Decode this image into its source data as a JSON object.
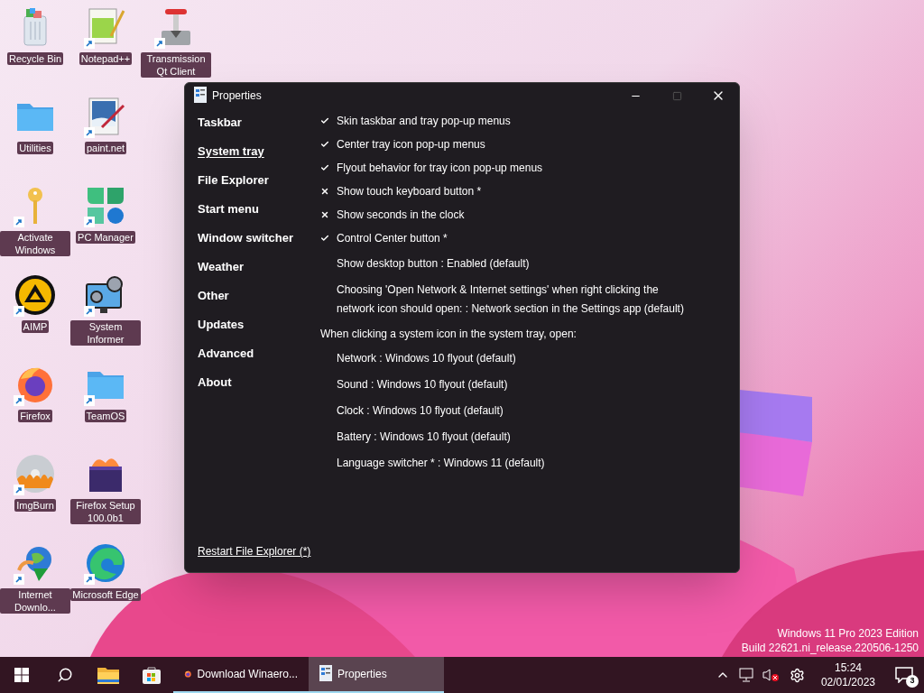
{
  "desktop_icons": [
    {
      "label": "Recycle Bin",
      "kind": "recycle",
      "shortcut": false
    },
    {
      "label": "Utilities",
      "kind": "folder",
      "shortcut": false
    },
    {
      "label": "Activate Windows",
      "kind": "key",
      "shortcut": true
    },
    {
      "label": "AIMP",
      "kind": "aimp",
      "shortcut": true
    },
    {
      "label": "Firefox",
      "kind": "firefox",
      "shortcut": true
    },
    {
      "label": "ImgBurn",
      "kind": "disc",
      "shortcut": true
    },
    {
      "label": "Internet Downlo...",
      "kind": "globe",
      "shortcut": true
    },
    {
      "label": "Notepad++",
      "kind": "notepad",
      "shortcut": true
    },
    {
      "label": "paint.net",
      "kind": "paint",
      "shortcut": true
    },
    {
      "label": "PC Manager",
      "kind": "pcmanager",
      "shortcut": true
    },
    {
      "label": "System Informer",
      "kind": "monitor",
      "shortcut": true
    },
    {
      "label": "TeamOS",
      "kind": "folder",
      "shortcut": true
    },
    {
      "label": "Firefox Setup 100.0b1",
      "kind": "setup",
      "shortcut": false
    },
    {
      "label": "Microsoft Edge",
      "kind": "edge",
      "shortcut": true
    },
    {
      "label": "Transmission Qt Client",
      "kind": "transmission",
      "shortcut": true
    }
  ],
  "window": {
    "title": "Properties",
    "sidebar": [
      {
        "label": "Taskbar",
        "selected": false
      },
      {
        "label": "System tray",
        "selected": true
      },
      {
        "label": "File Explorer",
        "selected": false
      },
      {
        "label": "Start menu",
        "selected": false
      },
      {
        "label": "Window switcher",
        "selected": false
      },
      {
        "label": "Weather",
        "selected": false
      },
      {
        "label": "Other",
        "selected": false
      },
      {
        "label": "Updates",
        "selected": false
      },
      {
        "label": "Advanced",
        "selected": false
      },
      {
        "label": "About",
        "selected": false
      }
    ],
    "settings": [
      {
        "kind": "toggle",
        "label": "Skin taskbar and tray pop-up menus",
        "checked": true
      },
      {
        "kind": "toggle",
        "label": "Center tray icon pop-up menus",
        "checked": true
      },
      {
        "kind": "toggle",
        "label": "Flyout behavior for tray icon pop-up menus",
        "checked": true
      },
      {
        "kind": "toggle",
        "label": "Show touch keyboard button *",
        "checked": false
      },
      {
        "kind": "toggle",
        "label": "Show seconds in the clock",
        "checked": false
      },
      {
        "kind": "toggle",
        "label": "Control Center button *",
        "checked": true
      },
      {
        "kind": "option",
        "label": "Show desktop button : Enabled (default)"
      },
      {
        "kind": "option",
        "label": "Choosing 'Open Network & Internet settings' when right clicking the network icon should open: : Network section in the Settings app (default)"
      },
      {
        "kind": "heading",
        "label": "When clicking a system icon in the system tray, open:"
      },
      {
        "kind": "option",
        "label": "Network : Windows 10 flyout (default)"
      },
      {
        "kind": "option",
        "label": "Sound : Windows 10 flyout (default)"
      },
      {
        "kind": "option",
        "label": "Clock : Windows 10 flyout (default)"
      },
      {
        "kind": "option",
        "label": "Battery : Windows 10 flyout (default)"
      },
      {
        "kind": "option",
        "label": "Language switcher * : Windows 11 (default)"
      }
    ],
    "footer_link": "Restart File Explorer (*)"
  },
  "edition": {
    "line_1": "Windows 11 Pro 2023 Edition",
    "line_2": "Build 22621.ni_release.220506-1250"
  },
  "taskbar": {
    "pinned": [
      {
        "kind": "start"
      },
      {
        "kind": "search"
      },
      {
        "kind": "explorer"
      },
      {
        "kind": "store"
      }
    ],
    "apps": [
      {
        "label": "Download Winaero...",
        "kind": "firefox",
        "selected": false
      },
      {
        "label": "Properties",
        "kind": "properties",
        "selected": true
      }
    ],
    "time": "15:24",
    "date": "02/01/2023",
    "notifications": "3"
  }
}
